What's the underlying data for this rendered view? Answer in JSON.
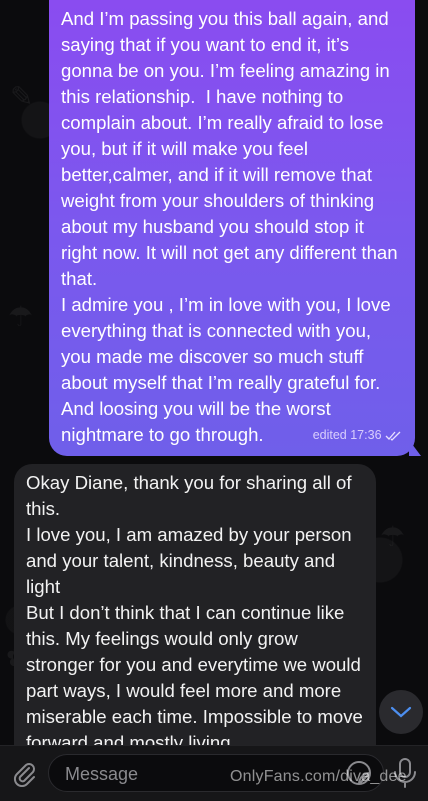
{
  "messages": {
    "outgoing": {
      "text": "And I’m passing you this ball again, and saying that if you want to end it, it’s gonna be on you. I’m feeling amazing in this relationship.  I have nothing to complain about. I’m really afraid to lose you, but if it will make you feel better,calmer, and if it will remove that weight from your shoulders of thinking about my husband you should stop it right now. It will not get any different than that.\nI admire you , I’m in love with you, I love everything that is connected with you, you made me discover so much stuff about myself that I’m really grateful for. And loosing you will be the worst nightmare to go through.",
      "status": "edited",
      "time": "17:36",
      "read_receipt_icon": "double-check-icon"
    },
    "incoming": {
      "text": "Okay Diane, thank you for sharing all of this.\nI love you, I am amazed by your person and your talent, kindness, beauty and light\nBut I don’t think that I can continue like this. My feelings would only grow stronger for you and everytime we would part ways, I would feel more and more miserable each time. Impossible to move forward and mostly living"
    }
  },
  "composer": {
    "placeholder": "Message",
    "attach_icon": "paperclip-icon",
    "sticker_icon": "sticker-icon",
    "mic_icon": "microphone-icon"
  },
  "scroll_button_icon": "chevron-down-icon",
  "watermark": "OnlyFans.com/diva_dee",
  "colors": {
    "outgoing_bubble_top": "#8a4cf0",
    "outgoing_bubble_bottom": "#6f5fea",
    "incoming_bubble": "#222225",
    "background": "#0b0b0d",
    "accent": "#4d8ff0"
  }
}
